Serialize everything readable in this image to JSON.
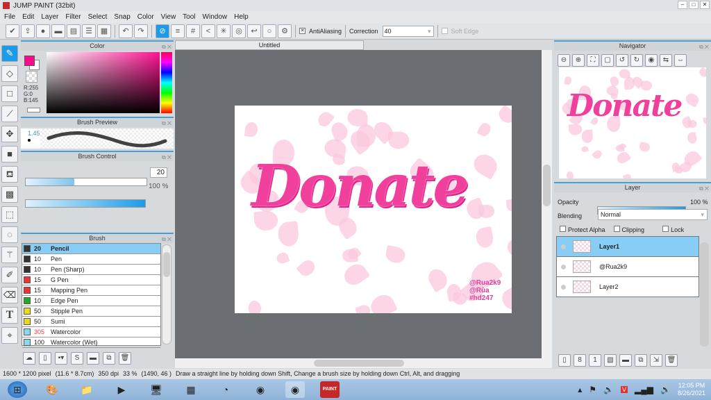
{
  "app": {
    "title": "JUMP PAINT (32bit)"
  },
  "menu": [
    "File",
    "Edit",
    "Layer",
    "Filter",
    "Select",
    "Snap",
    "Color",
    "View",
    "Tool",
    "Window",
    "Help"
  ],
  "toolbar": {
    "antialiasing_label": "AntiAliasing",
    "antialiasing_checked": true,
    "correction_label": "Correction",
    "correction_value": "40",
    "soft_edge_label": "Soft Edge"
  },
  "color_panel": {
    "title": "Color",
    "r": "R:255",
    "g": "G:0",
    "b": "B:145",
    "foreground": "#ff0a8c",
    "background": "#ffffff"
  },
  "brush_preview": {
    "title": "Brush Preview",
    "size": "1.45r"
  },
  "brush_control": {
    "title": "Brush Control",
    "size": "20",
    "size_fraction": 0.4,
    "opacity": "100 %"
  },
  "brush_panel": {
    "title": "Brush",
    "items": [
      {
        "size": "20",
        "name": "Pencil",
        "color": "#333333",
        "selected": true
      },
      {
        "size": "10",
        "name": "Pen",
        "color": "#333333"
      },
      {
        "size": "10",
        "name": "Pen (Sharp)",
        "color": "#333333"
      },
      {
        "size": "15",
        "name": "G Pen",
        "color": "#ee3333"
      },
      {
        "size": "15",
        "name": "Mapping Pen",
        "color": "#ee3333"
      },
      {
        "size": "10",
        "name": "Edge Pen",
        "color": "#22aa22"
      },
      {
        "size": "50",
        "name": "Stipple Pen",
        "color": "#e8d820"
      },
      {
        "size": "50",
        "name": "Sumi",
        "color": "#e8d820"
      },
      {
        "size": "305",
        "name": "Watercolor",
        "color": "#88d8f0"
      },
      {
        "size": "100",
        "name": "Watercolor (Wet)",
        "color": "#88d8f0"
      }
    ]
  },
  "document": {
    "tab": "Untitled",
    "artwork_text": "Donate",
    "watermark": [
      "@Rua2k9",
      "@Rùa",
      "#hd247"
    ]
  },
  "navigator": {
    "title": "Navigator"
  },
  "layer_panel": {
    "title": "Layer",
    "opacity_label": "Opacity",
    "opacity": "100 %",
    "blending_label": "Blending",
    "blending": "Normal",
    "protect_alpha": "Protect Alpha",
    "clipping": "Clipping",
    "lock": "Lock",
    "layers": [
      {
        "name": "Layer1",
        "selected": true
      },
      {
        "name": "@Rua2k9"
      },
      {
        "name": "Layer2"
      }
    ]
  },
  "status": {
    "size": "1600 * 1200 pixel",
    "cm": "(11.6 * 8.7cm)",
    "dpi": "350 dpi",
    "zoom": "33 %",
    "coords": "(1490, 46 )",
    "hint": "Draw a straight line by holding down Shift, Change a brush size by holding down Ctrl, Alt, and dragging"
  },
  "taskbar": {
    "time": "12:05 PM",
    "date": "8/26/2021"
  }
}
